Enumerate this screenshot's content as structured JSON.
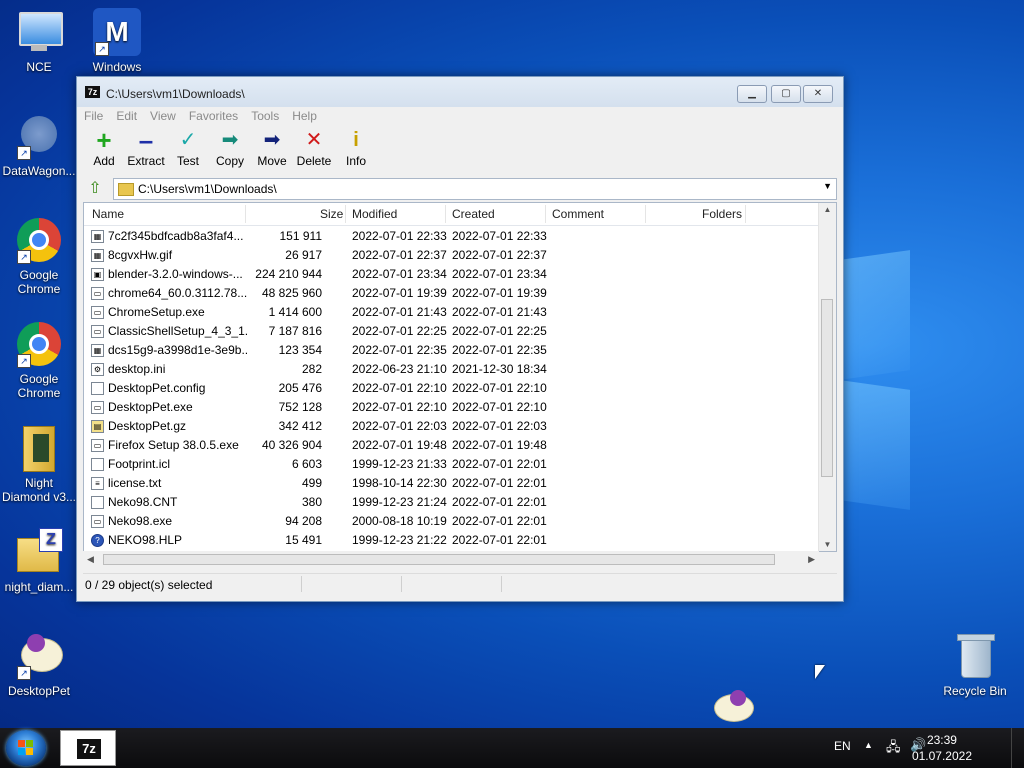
{
  "desktop": {
    "icons": [
      {
        "label": "NCE"
      },
      {
        "label": "Windows"
      },
      {
        "label": "DataWagon..."
      },
      {
        "label": "Google Chrome"
      },
      {
        "label": "Google Chrome"
      },
      {
        "label": "Night Diamond v3..."
      },
      {
        "label": "night_diam..."
      },
      {
        "label": "DesktopPet"
      },
      {
        "label": "Recycle Bin"
      }
    ]
  },
  "window": {
    "title": "C:\\Users\\vm1\\Downloads\\",
    "app_icon_text": "7z",
    "menu": [
      "File",
      "Edit",
      "View",
      "Favorites",
      "Tools",
      "Help"
    ],
    "toolbar": [
      "Add",
      "Extract",
      "Test",
      "Copy",
      "Move",
      "Delete",
      "Info"
    ],
    "address": "C:\\Users\\vm1\\Downloads\\",
    "columns": [
      "Name",
      "Size",
      "Modified",
      "Created",
      "Comment",
      "Folders"
    ],
    "files": [
      {
        "name": "7c2f345bdfcadb8a3faf4...",
        "size": "151 911",
        "modified": "2022-07-01 22:33",
        "created": "2022-07-01 22:33",
        "icon": "image-file-icon"
      },
      {
        "name": "8cgvxHw.gif",
        "size": "26 917",
        "modified": "2022-07-01 22:37",
        "created": "2022-07-01 22:37",
        "icon": "image-file-icon"
      },
      {
        "name": "blender-3.2.0-windows-...",
        "size": "224 210 944",
        "modified": "2022-07-01 23:34",
        "created": "2022-07-01 23:34",
        "icon": "installer-file-icon"
      },
      {
        "name": "chrome64_60.0.3112.78....",
        "size": "48 825 960",
        "modified": "2022-07-01 19:39",
        "created": "2022-07-01 19:39",
        "icon": "exe-file-icon"
      },
      {
        "name": "ChromeSetup.exe",
        "size": "1 414 600",
        "modified": "2022-07-01 21:43",
        "created": "2022-07-01 21:43",
        "icon": "exe-file-icon"
      },
      {
        "name": "ClassicShellSetup_4_3_1....",
        "size": "7 187 816",
        "modified": "2022-07-01 22:25",
        "created": "2022-07-01 22:25",
        "icon": "exe-file-icon"
      },
      {
        "name": "dcs15g9-a3998d1e-3e9b...",
        "size": "123 354",
        "modified": "2022-07-01 22:35",
        "created": "2022-07-01 22:35",
        "icon": "image-file-icon"
      },
      {
        "name": "desktop.ini",
        "size": "282",
        "modified": "2022-06-23 21:10",
        "created": "2021-12-30 18:34",
        "icon": "settings-file-icon"
      },
      {
        "name": "DesktopPet.config",
        "size": "205 476",
        "modified": "2022-07-01 22:10",
        "created": "2022-07-01 22:10",
        "icon": "blank-file-icon"
      },
      {
        "name": "DesktopPet.exe",
        "size": "752 128",
        "modified": "2022-07-01 22:10",
        "created": "2022-07-01 22:10",
        "icon": "exe-file-icon"
      },
      {
        "name": "DesktopPet.gz",
        "size": "342 412",
        "modified": "2022-07-01 22:03",
        "created": "2022-07-01 22:03",
        "icon": "archive-file-icon"
      },
      {
        "name": "Firefox Setup 38.0.5.exe",
        "size": "40 326 904",
        "modified": "2022-07-01 19:48",
        "created": "2022-07-01 19:48",
        "icon": "exe-file-icon"
      },
      {
        "name": "Footprint.icl",
        "size": "6 603",
        "modified": "1999-12-23 21:33",
        "created": "2022-07-01 22:01",
        "icon": "blank-file-icon"
      },
      {
        "name": "license.txt",
        "size": "499",
        "modified": "1998-10-14 22:30",
        "created": "2022-07-01 22:01",
        "icon": "text-file-icon"
      },
      {
        "name": "Neko98.CNT",
        "size": "380",
        "modified": "1999-12-23 21:24",
        "created": "2022-07-01 22:01",
        "icon": "blank-file-icon"
      },
      {
        "name": "Neko98.exe",
        "size": "94 208",
        "modified": "2000-08-18 10:19",
        "created": "2022-07-01 22:01",
        "icon": "exe-file-icon"
      },
      {
        "name": "NEKO98.HLP",
        "size": "15 491",
        "modified": "1999-12-23 21:22",
        "created": "2022-07-01 22:01",
        "icon": "help-file-icon"
      }
    ],
    "status": "0 / 29 object(s) selected"
  },
  "taskbar": {
    "app_label": "7z",
    "language": "EN",
    "time": "23:39",
    "date": "01.07.2022"
  }
}
